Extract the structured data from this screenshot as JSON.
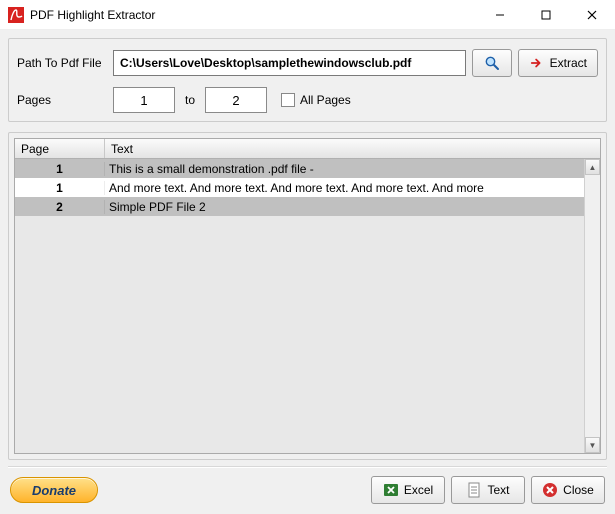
{
  "window": {
    "title": "PDF Highlight Extractor"
  },
  "labels": {
    "path": "Path To Pdf File",
    "pages": "Pages",
    "to": "to",
    "all_pages": "All Pages"
  },
  "inputs": {
    "path_value": "C:\\Users\\Love\\Desktop\\samplethewindowsclub.pdf",
    "page_from": "1",
    "page_to": "2",
    "all_pages_checked": false
  },
  "buttons": {
    "browse_aria": "Browse",
    "extract": "Extract",
    "donate": "Donate",
    "excel": "Excel",
    "text": "Text",
    "close": "Close"
  },
  "table": {
    "headers": {
      "page": "Page",
      "text": "Text"
    },
    "rows": [
      {
        "page": "1",
        "text": "This is a small demonstration .pdf file -"
      },
      {
        "page": "1",
        "text": "And more text. And more text. And more text. And more text. And more"
      },
      {
        "page": "2",
        "text": "Simple PDF File 2"
      }
    ]
  }
}
